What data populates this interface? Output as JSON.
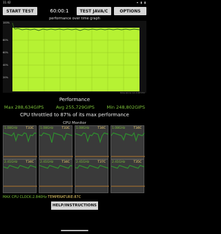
{
  "status_bar": {
    "time": "11:42",
    "icons": "▾ ▮ ▮"
  },
  "toolbar": {
    "start_label": "START TEST",
    "timer": "60:00:1",
    "java_label": "TEST JAVA/C",
    "options_label": "OPTIONS"
  },
  "graph": {
    "title": "performance over time graph",
    "y_labels": [
      "100%",
      "80%",
      "60%",
      "40%",
      "20%"
    ],
    "note": "time since run 1:00 min",
    "fill_color": "#b6f233",
    "line_color": "#2e5f1a"
  },
  "performance": {
    "title": "Performance",
    "max": "Max 288,634GIPS",
    "avg": "Avg 255,729GIPS",
    "min": "Min 248,802GIPS",
    "throttle_text": "CPU throttled to 87% of its max performance"
  },
  "cpu_monitor": {
    "title": "CPU Monitor",
    "cores": [
      {
        "freq": "1.08GHz",
        "temp": "T33C"
      },
      {
        "freq": "1.08GHz",
        "temp": "T33C"
      },
      {
        "freq": "1.08GHz",
        "temp": "T34C"
      },
      {
        "freq": "1.08GHz",
        "temp": "T34C"
      },
      {
        "freq": "2.41GHz",
        "temp": "T34C"
      },
      {
        "freq": "2.41GHz",
        "temp": "T34C"
      },
      {
        "freq": "2.41GHz",
        "temp": "T37C"
      },
      {
        "freq": "2.41GHz",
        "temp": "T35C"
      }
    ],
    "max_clock_label": "MAX CPU CLOCK:2.840Hz",
    "temperature_label": "TEMPERATURE:87C"
  },
  "help_label": "HELP/INSTRUCTIONS"
}
